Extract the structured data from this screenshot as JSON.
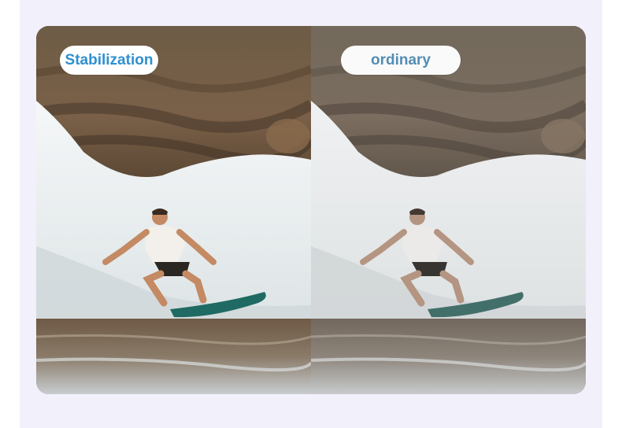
{
  "comparison": {
    "left_label": "Stabilization",
    "right_label": "ordinary"
  },
  "colors": {
    "label_text": "#2f8fd0",
    "label_background": "#ffffff",
    "page_background": "#f2f0fb"
  },
  "scene": {
    "subject": "surfer-on-wave",
    "surfboard_color": "#1f6b63"
  }
}
